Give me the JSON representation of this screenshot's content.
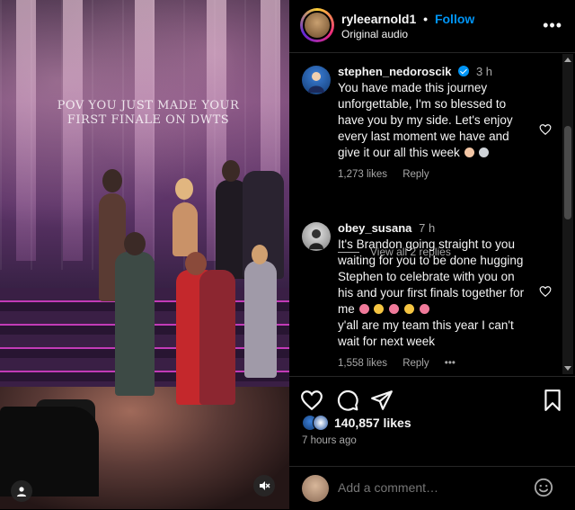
{
  "video": {
    "caption_line1": "POV YOU JUST MADE YOUR",
    "caption_line2": "FIRST FINALE ON DWTS",
    "mute_icon": "speaker-muted-icon",
    "user_tag_icon": "user-tag-icon"
  },
  "header": {
    "username": "ryleearnold1",
    "separator": "•",
    "follow_label": "Follow",
    "audio_label": "Original audio",
    "more_label": "•••"
  },
  "comments": [
    {
      "username": "stephen_nedoroscik",
      "verified": true,
      "time": "3 h",
      "text": "You have made this journey unforgettable, I'm so blessed to have you by my side. Let's enjoy every last moment we have and give it our all this week",
      "likes": "1,273 likes",
      "reply_label": "Reply"
    },
    {
      "username": "obey_susana",
      "verified": false,
      "time": "7 h",
      "text_line1": "It's Brandon going straight to you waiting for you to be done hugging Stephen to celebrate with you on his and your first finals together for me",
      "text_line2": "y'all are my team this year I can't wait for next week",
      "likes": "1,558 likes",
      "reply_label": "Reply",
      "more_label": "•••"
    }
  ],
  "view_replies_label": "View all 2 replies",
  "actions": {
    "likes_count": "140,857 likes",
    "time_ago": "7 hours ago"
  },
  "add_comment": {
    "placeholder": "Add a comment…"
  },
  "colors": {
    "accent": "#0095f6",
    "text_secondary": "#a8a8a8",
    "background": "#000000"
  }
}
